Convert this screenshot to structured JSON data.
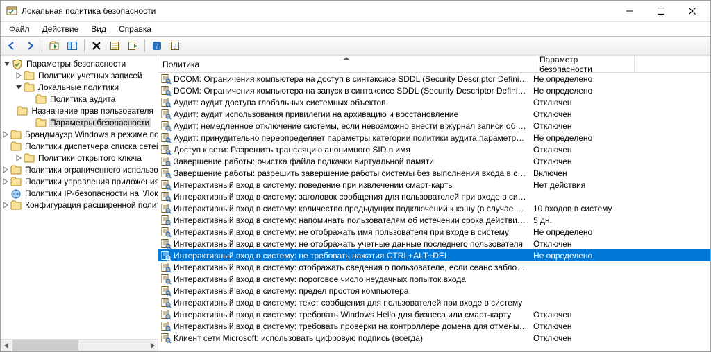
{
  "window": {
    "title": "Локальная политика безопасности"
  },
  "menu": {
    "file": "Файл",
    "action": "Действие",
    "view": "Вид",
    "help": "Справка"
  },
  "columns": {
    "policy": "Политика",
    "security": "Параметр безопасности"
  },
  "tree": [
    {
      "depth": 0,
      "expander": "open",
      "icon": "shield",
      "label": "Параметры безопасности"
    },
    {
      "depth": 1,
      "expander": "closed",
      "icon": "folder",
      "label": "Политики учетных записей"
    },
    {
      "depth": 1,
      "expander": "open",
      "icon": "folder",
      "label": "Локальные политики"
    },
    {
      "depth": 2,
      "expander": "none",
      "icon": "folder",
      "label": "Политика аудита"
    },
    {
      "depth": 2,
      "expander": "none",
      "icon": "folder",
      "label": "Назначение прав пользователя"
    },
    {
      "depth": 2,
      "expander": "none",
      "icon": "folder",
      "label": "Параметры безопасности",
      "selected": true
    },
    {
      "depth": 1,
      "expander": "closed",
      "icon": "folder",
      "label": "Брандмауэр Windows в режиме пов"
    },
    {
      "depth": 1,
      "expander": "none",
      "icon": "folder",
      "label": "Политики диспетчера списка сетей"
    },
    {
      "depth": 1,
      "expander": "closed",
      "icon": "folder",
      "label": "Политики открытого ключа"
    },
    {
      "depth": 1,
      "expander": "closed",
      "icon": "folder",
      "label": "Политики ограниченного использо"
    },
    {
      "depth": 1,
      "expander": "closed",
      "icon": "folder",
      "label": "Политики управления приложения"
    },
    {
      "depth": 1,
      "expander": "none",
      "icon": "ipsec",
      "label": "Политики IP-безопасности на \"Лока"
    },
    {
      "depth": 1,
      "expander": "closed",
      "icon": "folder",
      "label": "Конфигурация расширенной полит"
    }
  ],
  "policies": [
    {
      "name": "DCOM: Ограничения компьютера на доступ в синтаксисе SDDL (Security Descriptor Definition Language)",
      "value": "Не определено"
    },
    {
      "name": "DCOM: Ограничения компьютера на запуск в синтаксисе SDDL (Security Descriptor Definition Language)",
      "value": "Не определено"
    },
    {
      "name": "Аудит: аудит доступа глобальных системных объектов",
      "value": "Отключен"
    },
    {
      "name": "Аудит: аудит использования привилегии на архивацию и восстановление",
      "value": "Отключен"
    },
    {
      "name": "Аудит: немедленное отключение системы, если невозможно внести в журнал записи об аудите безо...",
      "value": "Отключен"
    },
    {
      "name": "Аудит: принудительно переопределяет параметры категории политики аудита параметрами подкатег...",
      "value": "Не определено"
    },
    {
      "name": "Доступ к сети: Разрешить трансляцию анонимного SID в имя",
      "value": "Отключен"
    },
    {
      "name": "Завершение работы: очистка файла подкачки виртуальной памяти",
      "value": "Отключен"
    },
    {
      "name": "Завершение работы: разрешить завершение работы системы без выполнения входа в систему",
      "value": "Включен"
    },
    {
      "name": "Интерактивный вход в систему: поведение при извлечении смарт-карты",
      "value": "Нет действия"
    },
    {
      "name": "Интерактивный вход в систему: заголовок сообщения для пользователей при входе в систему",
      "value": ""
    },
    {
      "name": "Интерактивный вход в систему: количество предыдущих подключений к кэшу (в случае отсутствия д...",
      "value": "10 входов в систему"
    },
    {
      "name": "Интерактивный вход в систему: напоминать пользователям об истечении срока действия пароля зар...",
      "value": "5 дн."
    },
    {
      "name": "Интерактивный вход в систему: не отображать имя пользователя при входе в систему",
      "value": "Не определено"
    },
    {
      "name": "Интерактивный вход в систему: не отображать учетные данные последнего пользователя",
      "value": "Отключен"
    },
    {
      "name": "Интерактивный вход в систему: не требовать нажатия CTRL+ALT+DEL",
      "value": "Не определено",
      "selected": true
    },
    {
      "name": "Интерактивный вход в систему: отображать сведения о пользователе, если сеанс заблокирован.",
      "value": ""
    },
    {
      "name": "Интерактивный вход в систему: пороговое число неудачных попыток входа",
      "value": ""
    },
    {
      "name": "Интерактивный вход в систему: предел простоя компьютера",
      "value": ""
    },
    {
      "name": "Интерактивный вход в систему: текст сообщения для пользователей при входе в систему",
      "value": ""
    },
    {
      "name": "Интерактивный вход в систему: требовать Windows Hello для бизнеса или смарт-карту",
      "value": "Отключен"
    },
    {
      "name": "Интерактивный вход в систему: требовать проверки на контроллере домена для отмены блокировки ...",
      "value": "Отключен"
    },
    {
      "name": "Клиент сети Microsoft: использовать цифровую подпись (всегда)",
      "value": "Отключен"
    }
  ]
}
